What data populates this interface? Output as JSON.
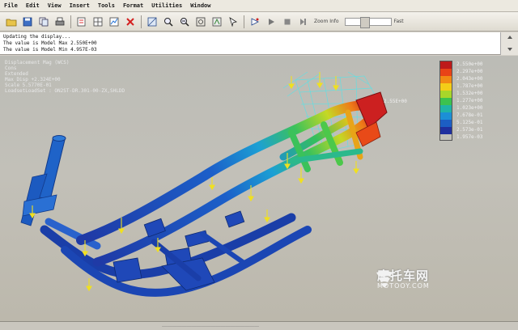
{
  "menu": [
    "File",
    "Edit",
    "View",
    "Insert",
    "Tools",
    "Format",
    "Utilities",
    "Window"
  ],
  "toolbar": {
    "icons": [
      "open-folder-icon",
      "save-icon",
      "copy-icon",
      "print-icon",
      "print-preview-icon",
      "grid-display-icon",
      "plot-display-icon",
      "delete-icon",
      "mesh-view-icon",
      "zoom-area-icon",
      "zoom-out-icon",
      "fit-view-icon",
      "pan-icon",
      "select-icon",
      "rotate-icon",
      "animation-play-icon",
      "animation-stop-icon",
      "animation-step-icon"
    ],
    "anim_label": "Zoom Info",
    "speed_label": "Fast"
  },
  "messages": [
    "Updating the display...",
    "The value is Model Max  2.550E+00",
    "The value is Model Min  4.957E-03"
  ],
  "viewport": {
    "info": [
      "Displacement Mag (WCS)",
      "Cons",
      "Extended",
      "Max Disp +2.324E+00",
      "Scale  5.5770E-01",
      "LoadsetLoadSet : ON2ST-DR.301-00-ZX,SHLDD"
    ],
    "peak_label": "2.55E+00"
  },
  "legend": {
    "colors": [
      "#bd1a1a",
      "#e84317",
      "#f18a14",
      "#f3cd18",
      "#a8d62a",
      "#3cc24e",
      "#20b4a6",
      "#1c8fd6",
      "#1c5ec4",
      "#1f2f9e"
    ],
    "values": [
      "2.550e+00",
      "2.297e+00",
      "2.043e+00",
      "1.787e+00",
      "1.532e+00",
      "1.277e+00",
      "1.023e+00",
      "7.678e-01",
      "5.125e-01",
      "2.573e-01",
      "1.957e-03"
    ]
  },
  "watermark": {
    "cn": "摩托车网",
    "en": "MOTOOY.COM"
  },
  "status": {
    "text": "……………………………………………………"
  }
}
